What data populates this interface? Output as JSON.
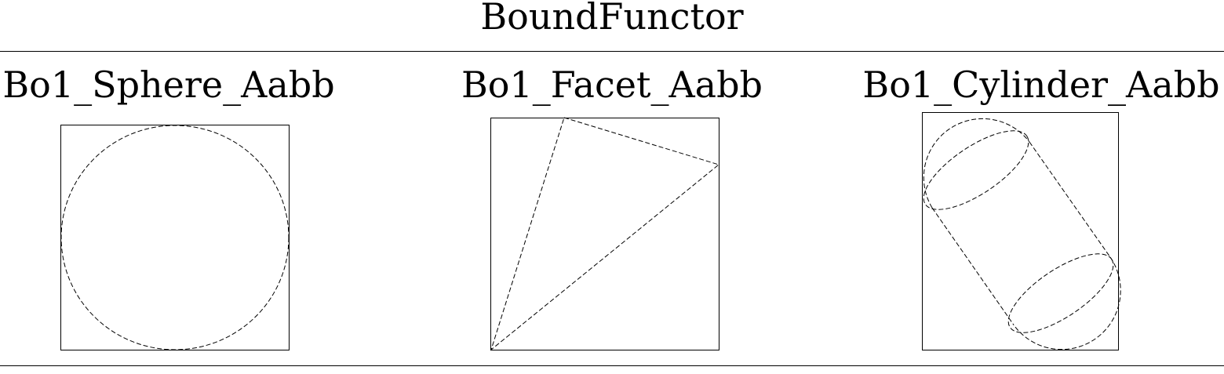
{
  "title": "BoundFunctor",
  "panels": [
    {
      "label": "Bo1_Sphere_Aabb",
      "shape_icon": "sphere-icon"
    },
    {
      "label": "Bo1_Facet_Aabb",
      "shape_icon": "facet-triangle-icon"
    },
    {
      "label": "Bo1_Cylinder_Aabb",
      "shape_icon": "cylinder-icon"
    }
  ],
  "colors": {
    "stroke": "#000000",
    "background": "#ffffff"
  }
}
